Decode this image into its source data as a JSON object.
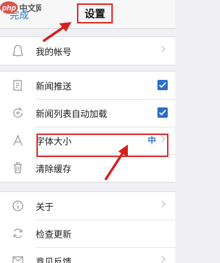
{
  "navbar": {
    "done_label": "完成",
    "title": "设置"
  },
  "watermark": {
    "text": "中文网",
    "logo_text": "php"
  },
  "groups": [
    {
      "items": [
        {
          "label": "我的帐号",
          "icon": "account-icon",
          "accessory": "chevron"
        }
      ]
    },
    {
      "items": [
        {
          "label": "新闻推送",
          "icon": "news-push-icon",
          "accessory": "checkbox",
          "checked": true
        },
        {
          "label": "新闻列表自动加载",
          "icon": "auto-load-icon",
          "accessory": "checkbox",
          "checked": true
        },
        {
          "label": "字体大小",
          "icon": "font-size-icon",
          "accessory": "chevron",
          "value": "中"
        },
        {
          "label": "清除缓存",
          "icon": "trash-icon",
          "accessory": "none"
        }
      ]
    },
    {
      "items": [
        {
          "label": "关于",
          "icon": "info-icon",
          "accessory": "chevron"
        },
        {
          "label": "检查更新",
          "icon": "refresh-icon",
          "accessory": "none"
        },
        {
          "label": "意见反馈",
          "icon": "feedback-icon",
          "accessory": "chevron"
        }
      ]
    }
  ],
  "colors": {
    "accent": "#2b78d2",
    "highlight": "#e02020",
    "checkbox": "#2a6fc9",
    "background": "#efeff4"
  }
}
